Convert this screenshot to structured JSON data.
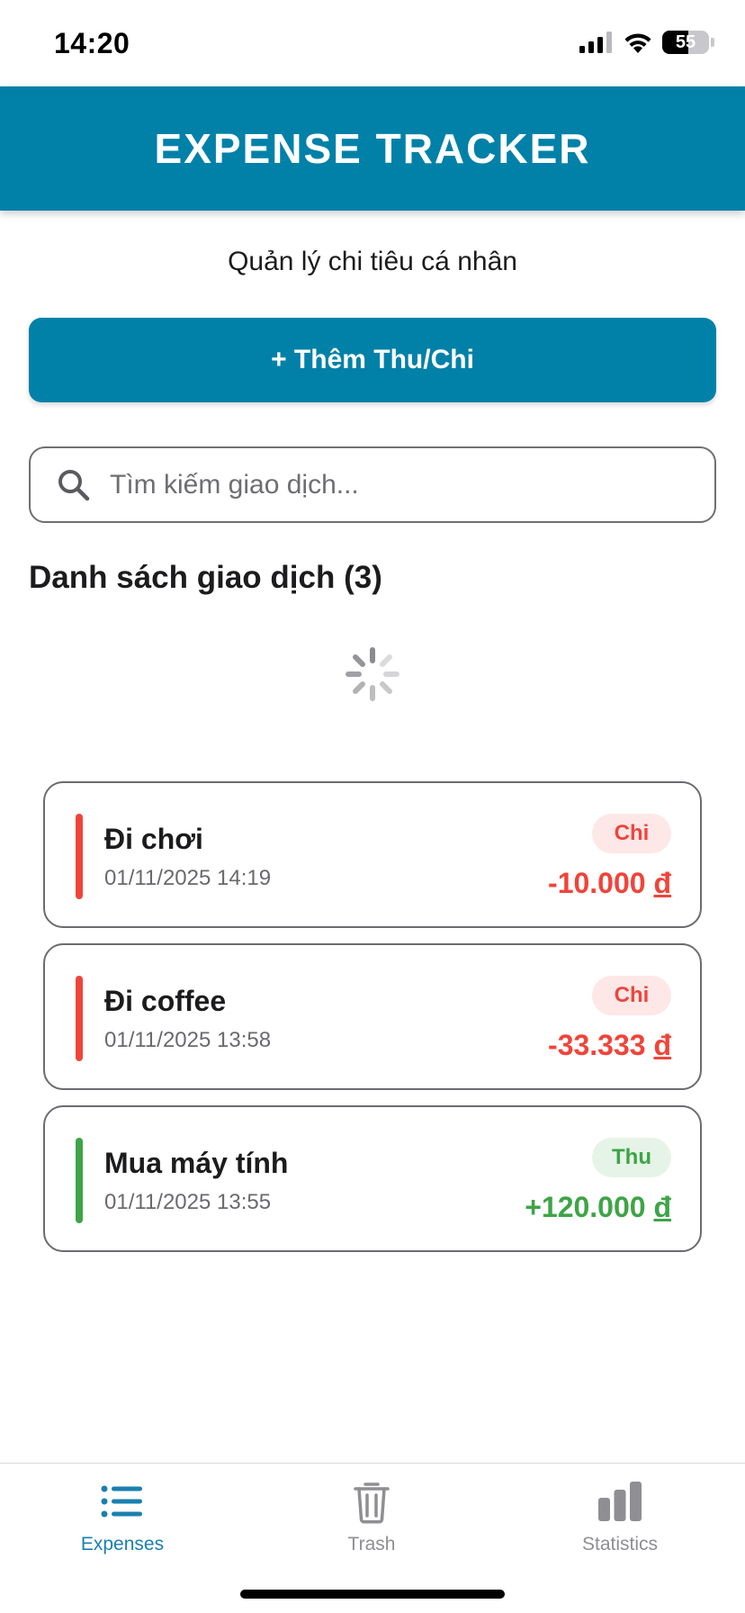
{
  "status_bar": {
    "time": "14:20",
    "battery": "55"
  },
  "header": {
    "title": "EXPENSE TRACKER"
  },
  "subtitle": "Quản lý chi tiêu cá nhân",
  "add_button": {
    "label": "+ Thêm Thu/Chi"
  },
  "search": {
    "placeholder": "Tìm kiếm giao dịch..."
  },
  "list_heading": "Danh sách giao dịch (3)",
  "colors": {
    "primary": "#0181a8",
    "expense": "#f0443a",
    "expense_badge_bg": "#fde7e7",
    "income": "#3ea447",
    "income_badge_bg": "#e6f4e7",
    "tab_active": "#1a7fb0",
    "tab_inactive": "#8e8e93"
  },
  "transactions": [
    {
      "name": "Đi chơi",
      "date": "01/11/2025 14:19",
      "type": "Chi",
      "amount": "-10.000",
      "currency": "đ"
    },
    {
      "name": "Đi coffee",
      "date": "01/11/2025 13:58",
      "type": "Chi",
      "amount": "-33.333",
      "currency": "đ"
    },
    {
      "name": "Mua máy tính",
      "date": "01/11/2025 13:55",
      "type": "Thu",
      "amount": "+120.000",
      "currency": "đ"
    }
  ],
  "tabs": [
    {
      "label": "Expenses",
      "icon": "list-icon",
      "active": true
    },
    {
      "label": "Trash",
      "icon": "trash-icon",
      "active": false
    },
    {
      "label": "Statistics",
      "icon": "bar-chart-icon",
      "active": false
    }
  ]
}
